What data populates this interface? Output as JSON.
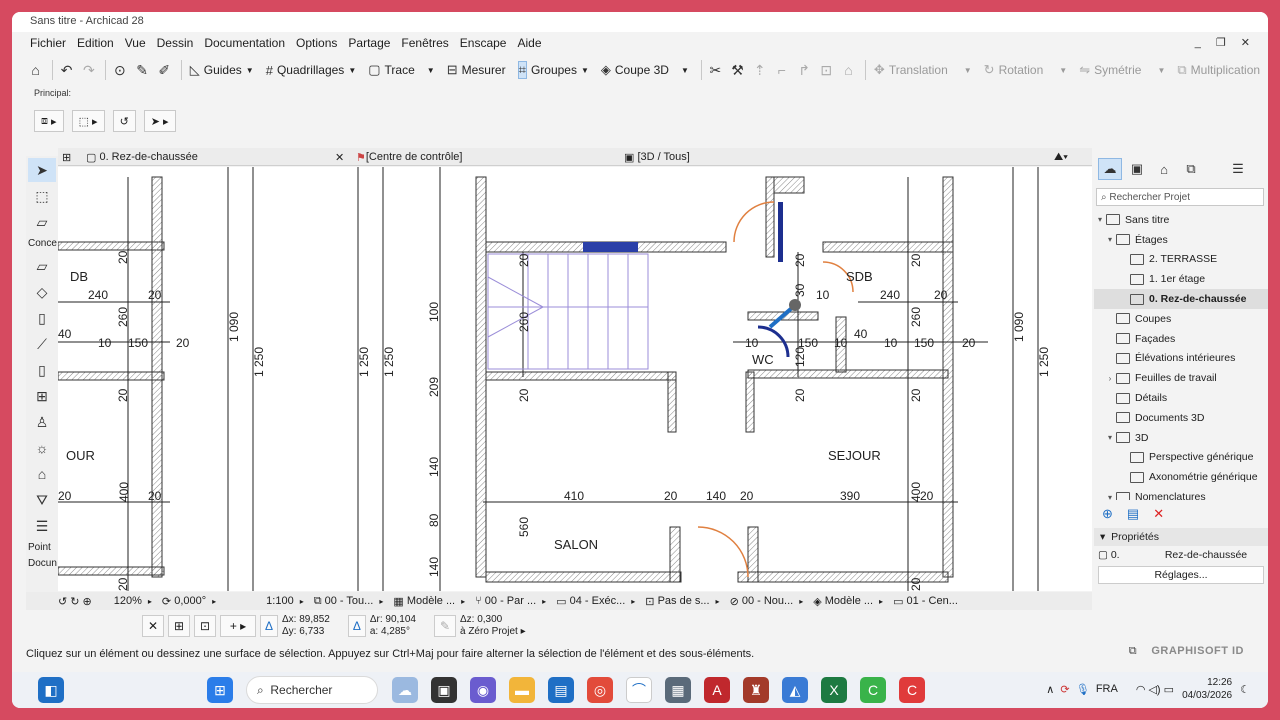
{
  "window": {
    "title": "Sans titre - Archicad 28",
    "controls": "_ ❐ ✕"
  },
  "menu": [
    "Fichier",
    "Edition",
    "Vue",
    "Dessin",
    "Documentation",
    "Options",
    "Partage",
    "Fenêtres",
    "Enscape",
    "Aide"
  ],
  "toolbar": {
    "guides": "Guides",
    "quadrillages": "Quadrillages",
    "trace": "Trace",
    "mesurer": "Mesurer",
    "groupes": "Groupes",
    "coupe3d": "Coupe 3D",
    "translation": "Translation",
    "rotation": "Rotation",
    "symetrie": "Symétrie",
    "multiplication": "Multiplication"
  },
  "principal_label": "Principal:",
  "toolbox_labels": {
    "conception": "Conce",
    "point": "Point",
    "document": "Docun"
  },
  "tabs": {
    "plan": "0. Rez-de-chaussée",
    "close": "✕",
    "centre": "[Centre de contrôle]",
    "vue3d": "[3D / Tous]"
  },
  "drawing": {
    "rooms": [
      "DB",
      "OUR",
      "SDB",
      "WC",
      "SEJOUR",
      "SALON"
    ],
    "dimensions": [
      "240",
      "20",
      "20",
      "40",
      "10",
      "150",
      "20",
      "260",
      "100",
      "1 090",
      "1 250",
      "1 250",
      "1 250",
      "209",
      "140",
      "80",
      "560",
      "140",
      "400",
      "20",
      "410",
      "20",
      "140",
      "20",
      "390",
      "400",
      "20",
      "240",
      "20",
      "40",
      "10",
      "150",
      "20",
      "1 090",
      "1 250",
      "260",
      "10",
      "30",
      "20",
      "10",
      "120",
      "20",
      "20",
      "20",
      "20",
      "20",
      "400",
      "20"
    ]
  },
  "canvasbar": {
    "zoom": "120%",
    "angle": "0,000°",
    "scale": "1:100",
    "layer": "00 - Tou...",
    "model": "Modèle ...",
    "partition": "00 - Par ...",
    "exec": "04 - Exéc...",
    "pas": "Pas de s...",
    "nouv": "00 - Nou...",
    "model2": "Modèle ...",
    "cen": "01 - Cen..."
  },
  "tracker": {
    "dx": "Δx: 89,852",
    "dy": "Δy: 6,733",
    "dr": "Δr: 90,104",
    "da": "a: 4,285°",
    "dz": "Δz: 0,300",
    "zero": "à Zéro Projet"
  },
  "status": {
    "message": "Cliquez sur un élément ou dessinez une surface de sélection. Appuyez sur Ctrl+Maj pour faire alterner la sélection de l'élément et des sous-éléments.",
    "brand": "GRAPHISOFT ID"
  },
  "navigator": {
    "search_placeholder": "Rechercher Projet",
    "items": [
      {
        "level": 0,
        "toggle": "▾",
        "label": "Sans titre"
      },
      {
        "level": 1,
        "toggle": "▾",
        "label": "Étages"
      },
      {
        "level": 2,
        "toggle": "",
        "label": "2. TERRASSE"
      },
      {
        "level": 2,
        "toggle": "",
        "label": "1. 1er étage"
      },
      {
        "level": 2,
        "toggle": "",
        "label": "0. Rez-de-chaussée",
        "selected": true
      },
      {
        "level": 1,
        "toggle": "",
        "label": "Coupes"
      },
      {
        "level": 1,
        "toggle": "",
        "label": "Façades"
      },
      {
        "level": 1,
        "toggle": "",
        "label": "Élévations intérieures"
      },
      {
        "level": 1,
        "toggle": "›",
        "label": "Feuilles de travail"
      },
      {
        "level": 1,
        "toggle": "",
        "label": "Détails"
      },
      {
        "level": 1,
        "toggle": "",
        "label": "Documents 3D"
      },
      {
        "level": 1,
        "toggle": "▾",
        "label": "3D"
      },
      {
        "level": 2,
        "toggle": "",
        "label": "Perspective générique"
      },
      {
        "level": 2,
        "toggle": "",
        "label": "Axonométrie générique"
      },
      {
        "level": 1,
        "toggle": "▾",
        "label": "Nomenclatures"
      }
    ],
    "properties_label": "Propriétés",
    "prop_id": "0.",
    "prop_name": "Rez-de-chaussée",
    "settings_button": "Réglages..."
  },
  "taskbar": {
    "search": "Rechercher",
    "lang": "FRA",
    "time": "12:26",
    "date": "04/03/2026"
  },
  "colors": {
    "accent": "#1f6fc5",
    "selection": "#cfe3f7",
    "window_bg": "#d64a60"
  }
}
